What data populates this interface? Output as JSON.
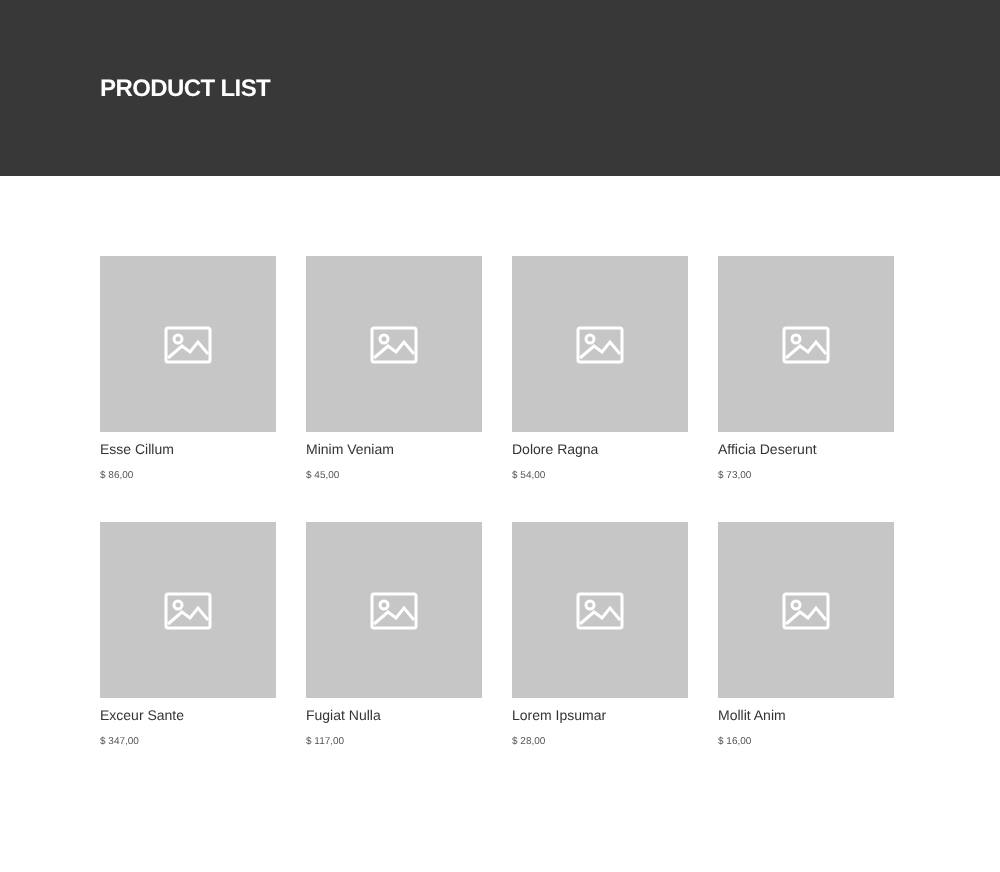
{
  "header": {
    "title": "PRODUCT LIST"
  },
  "products": [
    {
      "name": "Esse Cillum",
      "price": "$ 86,00",
      "kind": "picture"
    },
    {
      "name": "Minim Veniam",
      "price": "$ 45,00",
      "kind": "picture"
    },
    {
      "name": "Dolore Ragna",
      "price": "$ 54,00",
      "kind": "picture"
    },
    {
      "name": "Afficia Deserunt",
      "price": "$ 73,00",
      "kind": "picture"
    },
    {
      "name": "Exceur Sante",
      "price": "$ 347,00",
      "kind": "picture"
    },
    {
      "name": "Fugiat Nulla",
      "price": "$ 117,00",
      "kind": "picture"
    },
    {
      "name": "Lorem Ipsumar",
      "price": "$ 28,00",
      "kind": "picture"
    },
    {
      "name": "Mollit Anim",
      "price": "$ 16,00",
      "kind": "picture"
    }
  ]
}
